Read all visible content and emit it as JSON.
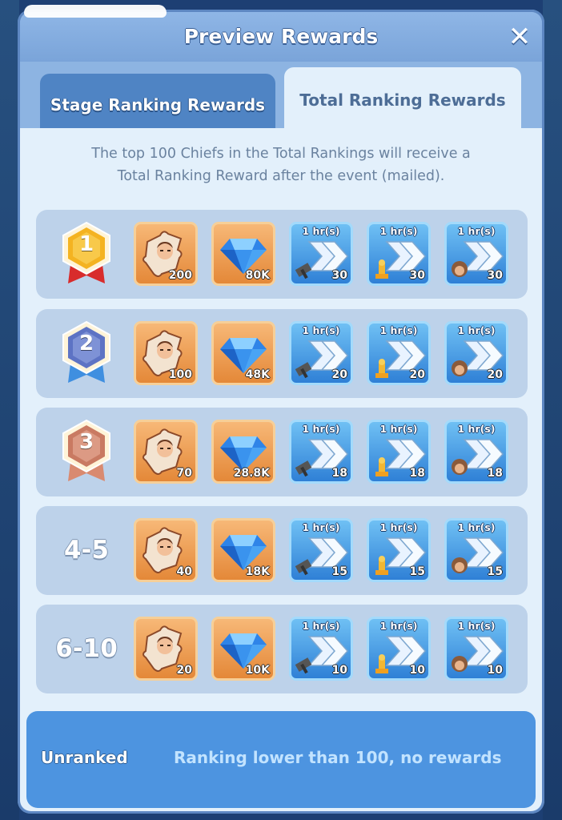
{
  "window": {
    "title": "Preview Rewards",
    "close_icon": "close-icon"
  },
  "tabs": [
    {
      "label": "Stage Ranking Rewards",
      "active": false
    },
    {
      "label": "Total Ranking Rewards",
      "active": true
    }
  ],
  "description": [
    "The top 100 Chiefs in the Total Rankings will receive a",
    "Total Ranking Reward after the event (mailed)."
  ],
  "hr_label": "1 hr(s)",
  "reward_items": [
    {
      "icon": "hero-puzzle-icon",
      "style": "orange"
    },
    {
      "icon": "gem-icon",
      "style": "orange"
    },
    {
      "icon": "construction-speedup-icon",
      "style": "blue"
    },
    {
      "icon": "research-speedup-icon",
      "style": "blue"
    },
    {
      "icon": "training-speedup-icon",
      "style": "blue"
    }
  ],
  "rows": [
    {
      "rank": "1",
      "rank_type": "gold-medal-icon",
      "quantities": [
        "200",
        "80K",
        "30",
        "30",
        "30"
      ]
    },
    {
      "rank": "2",
      "rank_type": "silver-medal-icon",
      "quantities": [
        "100",
        "48K",
        "20",
        "20",
        "20"
      ]
    },
    {
      "rank": "3",
      "rank_type": "bronze-medal-icon",
      "quantities": [
        "70",
        "28.8K",
        "18",
        "18",
        "18"
      ]
    },
    {
      "rank": "4-5",
      "rank_type": "text",
      "quantities": [
        "40",
        "18K",
        "15",
        "15",
        "15"
      ]
    },
    {
      "rank": "6-10",
      "rank_type": "text",
      "quantities": [
        "20",
        "10K",
        "10",
        "10",
        "10"
      ]
    }
  ],
  "unranked": {
    "label": "Unranked",
    "text": "Ranking lower than 100, no rewards"
  },
  "colors": {
    "gold": "#f4b321",
    "silver": "#5d73c4",
    "bronze": "#c97a62",
    "ribbon_red": "#d82c2c",
    "ribbon_blue": "#3f8fe0",
    "ribbon_bronze": "#d98a70"
  }
}
